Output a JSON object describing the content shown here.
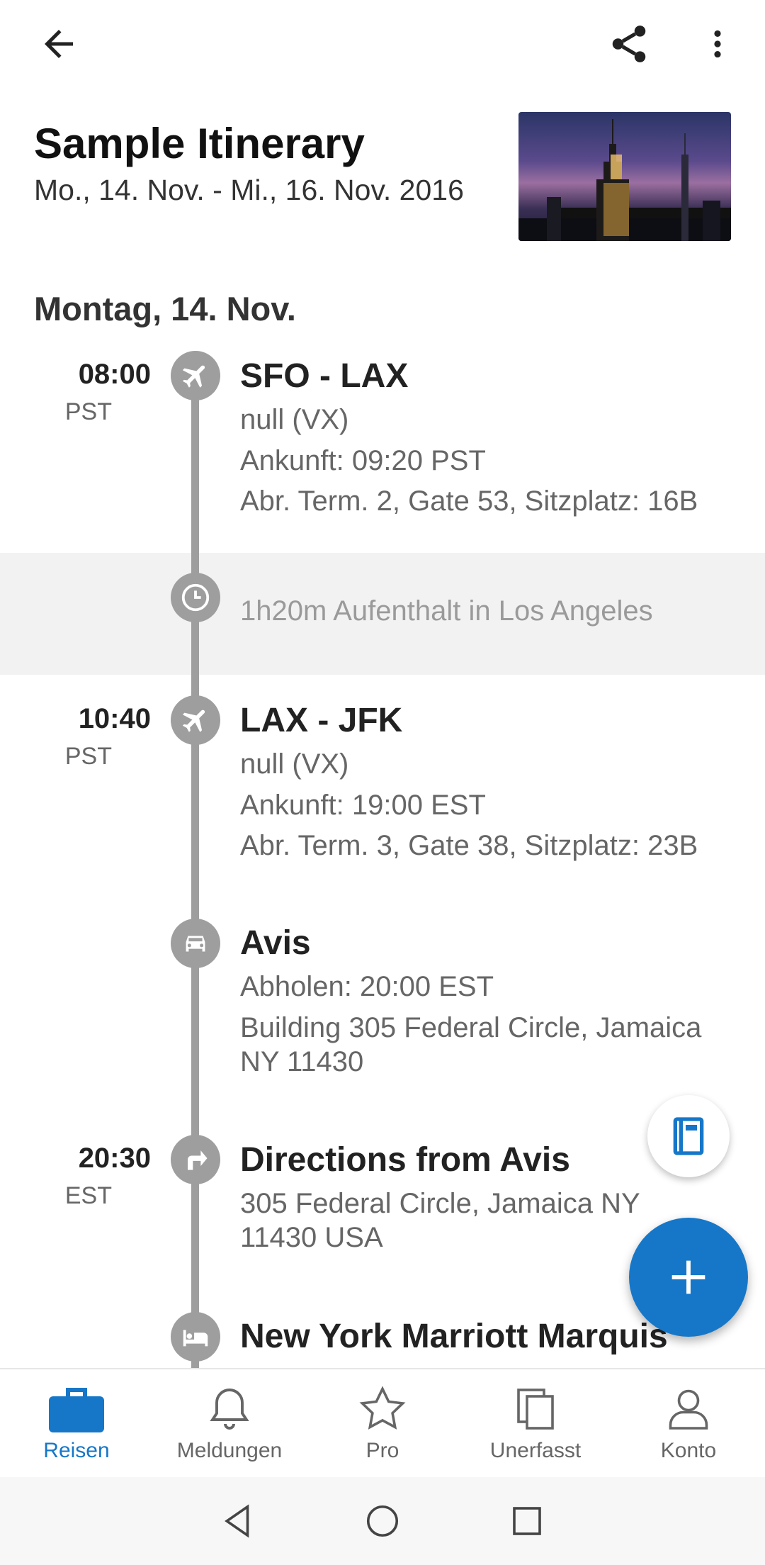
{
  "trip": {
    "title": "Sample Itinerary",
    "dates": "Mo., 14. Nov. - Mi., 16. Nov. 2016"
  },
  "day": {
    "header": "Montag, 14. Nov."
  },
  "events": [
    {
      "time": "08:00",
      "tz": "PST",
      "icon": "airplane-icon",
      "title": "SFO - LAX",
      "lines": [
        "null (VX)",
        "Ankunft: 09:20 PST",
        "Abr. Term. 2, Gate 53, Sitzplatz: 16B"
      ]
    },
    {
      "icon": "clock-icon",
      "layover": "1h20m Aufenthalt in Los Angeles"
    },
    {
      "time": "10:40",
      "tz": "PST",
      "icon": "airplane-icon",
      "title": "LAX - JFK",
      "lines": [
        "null (VX)",
        "Ankunft: 19:00 EST",
        "Abr. Term. 3, Gate 38, Sitzplatz: 23B"
      ]
    },
    {
      "icon": "car-icon",
      "title": "Avis",
      "lines": [
        "Abholen: 20:00 EST",
        "Building 305 Federal Circle, Jamaica",
        "NY 11430"
      ]
    },
    {
      "time": "20:30",
      "tz": "EST",
      "icon": "directions-icon",
      "title": "Directions from Avis",
      "lines": [
        "305 Federal Circle, Jamaica NY",
        "11430 USA"
      ]
    },
    {
      "icon": "bed-icon",
      "title": "New York Marriott Marquis"
    }
  ],
  "nav": [
    {
      "label": "Reisen",
      "icon": "briefcase-icon",
      "active": true
    },
    {
      "label": "Meldungen",
      "icon": "bell-icon"
    },
    {
      "label": "Pro",
      "icon": "star-icon"
    },
    {
      "label": "Unerfasst",
      "icon": "documents-icon"
    },
    {
      "label": "Konto",
      "icon": "person-icon"
    }
  ],
  "colors": {
    "accent": "#1677c8",
    "timeline": "#9e9e9e",
    "layover_bg": "#f2f2f2"
  }
}
